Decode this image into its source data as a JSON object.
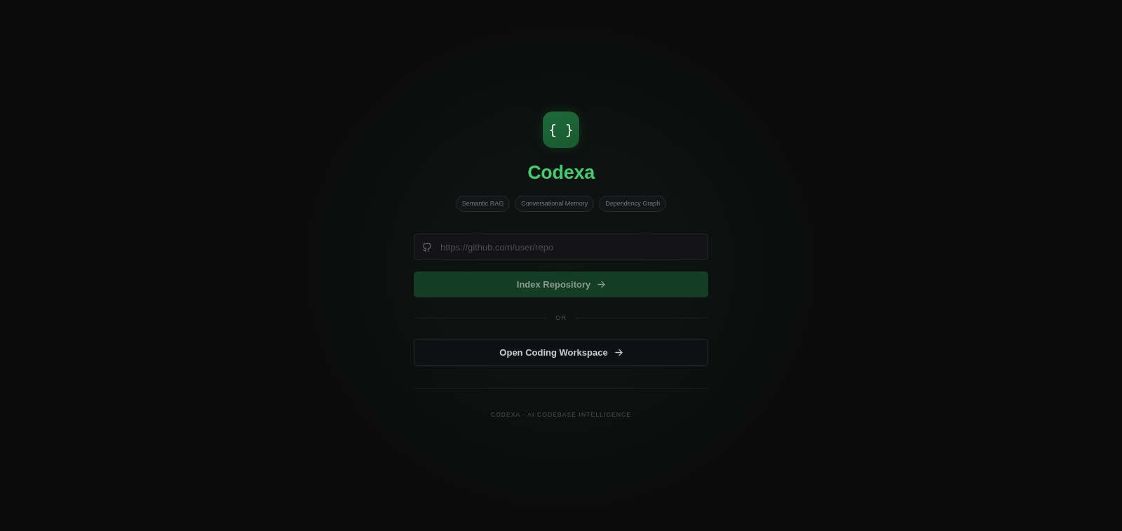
{
  "logo": {
    "glyph": "{ }"
  },
  "title": "Codexa",
  "features": [
    "Semantic RAG",
    "Conversational Memory",
    "Dependency Graph"
  ],
  "repo_field": {
    "placeholder": "https://github.com/user/repo"
  },
  "index_button": {
    "label": "Index Repository",
    "disabled": true
  },
  "separator": {
    "label": "OR"
  },
  "workspace_button": {
    "label": "Open Coding Workspace"
  },
  "footer": "CODEXA · AI CODEBASE INTELLIGENCE"
}
